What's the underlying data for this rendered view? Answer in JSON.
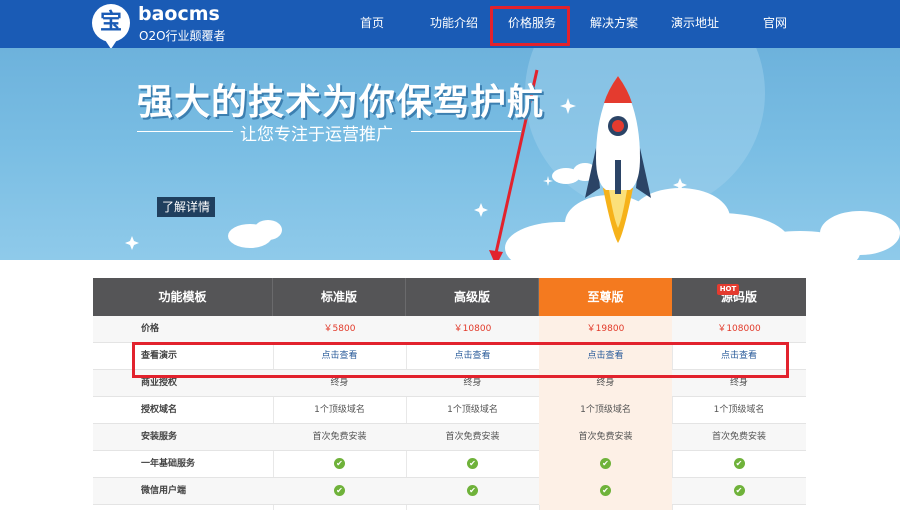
{
  "header": {
    "logo_glyph": "宝",
    "logo_name": "baocms",
    "slogan": "O2O行业颠覆者",
    "brand_color": "#1a5bb5",
    "nav": [
      "首页",
      "功能介绍",
      "价格服务",
      "解决方案",
      "演示地址",
      "官网"
    ],
    "active_nav": "价格服务",
    "highlight_color": "#e2222d"
  },
  "banner": {
    "headline": "强大的技术为你保驾护航",
    "subline": "让您专注于运营推广",
    "detail_button": "了解详情"
  },
  "pricing": {
    "hot_badge": "HOT",
    "featured_color": "#f47a1f",
    "headers": [
      "功能模板",
      "标准版",
      "高级版",
      "至尊版",
      "源码版"
    ],
    "rows": [
      {
        "label": "价格",
        "type": "price",
        "cells": [
          "￥5800",
          "￥10800",
          "￥19800",
          "￥108000"
        ]
      },
      {
        "label": "查看演示",
        "type": "link",
        "cells": [
          "点击查看",
          "点击查看",
          "点击查看",
          "点击查看"
        ]
      },
      {
        "label": "商业授权",
        "type": "text",
        "cells": [
          "终身",
          "终身",
          "终身",
          "终身"
        ]
      },
      {
        "label": "授权域名",
        "type": "text",
        "cells": [
          "1个顶级域名",
          "1个顶级域名",
          "1个顶级域名",
          "1个顶级域名"
        ]
      },
      {
        "label": "安装服务",
        "type": "text",
        "cells": [
          "首次免费安装",
          "首次免费安装",
          "首次免费安装",
          "首次免费安装"
        ]
      },
      {
        "label": "一年基础服务",
        "type": "check",
        "cells": [
          "✔",
          "✔",
          "✔",
          "✔"
        ]
      },
      {
        "label": "微信用户端",
        "type": "check",
        "cells": [
          "✔",
          "✔",
          "✔",
          "✔"
        ]
      }
    ]
  }
}
